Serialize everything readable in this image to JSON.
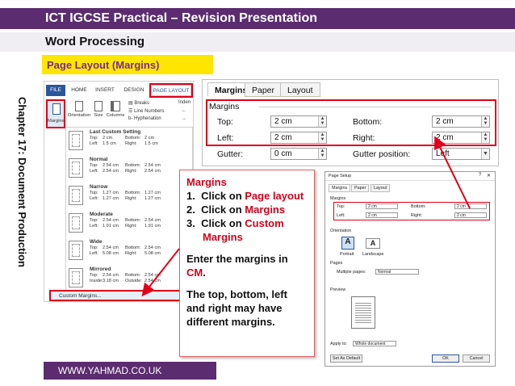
{
  "header": {
    "title": "ICT IGCSE Practical – Revision Presentation",
    "subtitle": "Word Processing",
    "topic": "Page Layout (Margins)",
    "chapter": "Chapter 17: Document Production",
    "footer": "WWW.YAHMAD.CO.UK"
  },
  "ribbon": {
    "tabs": [
      "FILE",
      "HOME",
      "INSERT",
      "DESIGN",
      "PAGE LAYOUT"
    ],
    "commands": [
      "Margins",
      "Orientation",
      "Size",
      "Columns"
    ],
    "breaks": "Breaks",
    "line_numbers": "Line Numbers",
    "hyphenation": "Hyphenation",
    "indent": "Inden",
    "spacing_fragments": [
      "←",
      "→"
    ],
    "margin_presets": [
      {
        "name": "Last Custom Setting",
        "l1": "Top:",
        "v1": "2 cm",
        "r1": "Bottom:",
        "rv1": "2 cm",
        "l2": "Left:",
        "v2": "1.5 cm",
        "r2": "Right:",
        "rv2": "1.5 cm"
      },
      {
        "name": "Normal",
        "l1": "Top:",
        "v1": "2.54 cm",
        "r1": "Bottom:",
        "rv1": "2.54 cm",
        "l2": "Left:",
        "v2": "2.54 cm",
        "r2": "Right:",
        "rv2": "2.54 cm"
      },
      {
        "name": "Narrow",
        "l1": "Top:",
        "v1": "1.27 cm",
        "r1": "Bottom:",
        "rv1": "1.27 cm",
        "l2": "Left:",
        "v2": "1.27 cm",
        "r2": "Right:",
        "rv2": "1.27 cm"
      },
      {
        "name": "Moderate",
        "l1": "Top:",
        "v1": "2.54 cm",
        "r1": "Bottom:",
        "rv1": "2.54 cm",
        "l2": "Left:",
        "v2": "1.91 cm",
        "r2": "Right:",
        "rv2": "1.91 cm"
      },
      {
        "name": "Wide",
        "l1": "Top:",
        "v1": "2.54 cm",
        "r1": "Bottom:",
        "rv1": "2.54 cm",
        "l2": "Left:",
        "v2": "5.08 cm",
        "r2": "Right:",
        "rv2": "5.08 cm"
      },
      {
        "name": "Mirrored",
        "l1": "Top:",
        "v1": "2.54 cm",
        "r1": "Bottom:",
        "rv1": "2.54 cm",
        "l2": "Inside:",
        "v2": "3.18 cm",
        "r2": "Outside:",
        "rv2": "2.54 cm"
      }
    ],
    "custom_margins": "Custom Margins..."
  },
  "dialog_big": {
    "tabs": [
      "Margins",
      "Paper",
      "Layout"
    ],
    "group": "Margins",
    "top_label": "Top:",
    "top_value": "2 cm",
    "bottom_label": "Bottom:",
    "bottom_value": "2 cm",
    "left_label": "Left:",
    "left_value": "2 cm",
    "right_label": "Right:",
    "right_value": "2 cm",
    "gutter_label": "Gutter:",
    "gutter_value": "0 cm",
    "gutter_pos_label": "Gutter position:",
    "gutter_pos_value": "Left"
  },
  "callout": {
    "heading": "Margins",
    "steps": [
      {
        "num": "1.",
        "pre": "Click on ",
        "link": "Page layout"
      },
      {
        "num": "2.",
        "pre": "Click on ",
        "link": "Margins"
      },
      {
        "num": "3.",
        "pre": "Click on ",
        "link": "Custom Margins"
      }
    ],
    "enter_pre": "Enter the margins in ",
    "enter_unit": "CM",
    "enter_post": ".",
    "note": "The top, bottom, left and right may have different margins."
  },
  "dialog_small": {
    "title": "Page Setup",
    "tabs": [
      "Margins",
      "Paper",
      "Layout"
    ],
    "margins_group": "Margins",
    "top_label": "Top:",
    "top_value": "2 cm",
    "bottom_label": "Bottom:",
    "bottom_value": "2 cm",
    "left_label": "Left:",
    "left_value": "2 cm",
    "right_label": "Right:",
    "right_value": "2 cm",
    "orientation_group": "Orientation",
    "portrait": "Portrait",
    "landscape": "Landscape",
    "pages_group": "Pages",
    "multiple_pages_label": "Multiple pages:",
    "multiple_pages_value": "Normal",
    "preview_group": "Preview",
    "apply_label": "Apply to:",
    "apply_value": "Whole document",
    "set_default": "Set As Default",
    "ok": "OK",
    "cancel": "Cancel"
  },
  "colors": {
    "title_bar": "#5b2c6f",
    "topic_bg": "#ffe600",
    "topic_text": "#7a2a8a",
    "highlight_red": "#e0001a",
    "word_blue": "#2b579a"
  }
}
